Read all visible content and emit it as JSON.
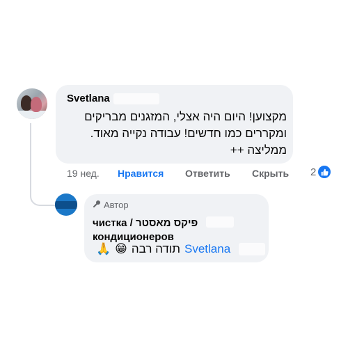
{
  "comment": {
    "author_name": "Svetlana",
    "text": "מקצוען! היום היה אצלי, המזגנים מבריקים ומקררים כמו חדשים! עבודה נקייה מאוד. ממליצה ++",
    "time": "19 нед.",
    "like_label": "Нравится",
    "reply_label": "Ответить",
    "hide_label": "Скрыть",
    "reaction_count": "2"
  },
  "reply": {
    "author_badge": "Автор",
    "author_name_hebrew": "פיקס מאסטר",
    "author_name_russian": "чистка / ",
    "author_name_line2": "кондиционеров",
    "text": "תודה רבה",
    "mention": "Svetlana",
    "emoji_grin": "😁",
    "emoji_pray": "🙏"
  }
}
